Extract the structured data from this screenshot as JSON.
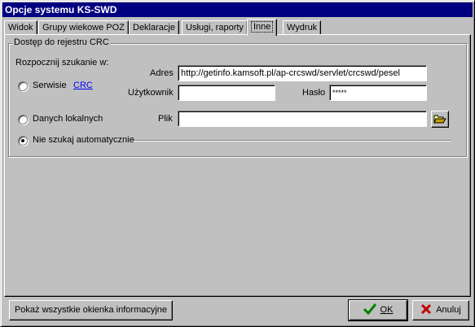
{
  "window": {
    "title": "Opcje systemu KS-SWD"
  },
  "tabs": [
    {
      "label": "Widok"
    },
    {
      "label": "Grupy wiekowe POZ"
    },
    {
      "label": "Deklaracje"
    },
    {
      "label": "Usługi, raporty"
    },
    {
      "label": "Inne"
    },
    {
      "label": "Wydruk"
    }
  ],
  "group": {
    "title": "Dostęp do rejestru CRC",
    "search_label": "Rozpocznij szukanie w:",
    "options": {
      "service_label": "Serwisie",
      "service_link": "CRC",
      "local_label": "Danych lokalnych",
      "none_label": "Nie szukaj automatycznie",
      "selected": "none"
    },
    "address_label": "Adres",
    "address_value": "http://getinfo.kamsoft.pl/ap-crcswd/servlet/crcswd/pesel",
    "user_label": "Użytkownik",
    "user_value": "",
    "password_label": "Hasło",
    "password_value": "*****",
    "file_label": "Plik",
    "file_value": ""
  },
  "buttons": {
    "show_all": "Pokaż wszystkie okienka informacyjne",
    "ok": "OK",
    "cancel": "Anuluj"
  },
  "colors": {
    "title_bar": "#000080",
    "link": "#0000ff",
    "ok_check": "#008000",
    "cancel_x": "#c00000"
  }
}
